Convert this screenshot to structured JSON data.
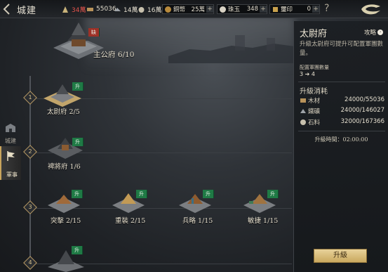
{
  "header": {
    "title": "城建",
    "resources": [
      {
        "icon": "troops-icon",
        "value": "34萬",
        "color": "#e0534b"
      },
      {
        "icon": "wood-icon",
        "value": "55036"
      },
      {
        "icon": "iron-icon",
        "value": "14萬"
      },
      {
        "icon": "stone-icon",
        "value": "16萬"
      }
    ],
    "pills": [
      {
        "icon": "copper-icon",
        "label": "銅幣",
        "value": "25萬"
      },
      {
        "icon": "jade-icon",
        "label": "珠玉",
        "value": "348"
      },
      {
        "icon": "gold-icon",
        "label": "璽印",
        "value": "0"
      }
    ],
    "help": "?"
  },
  "nav": [
    {
      "label": "城建",
      "active": false
    },
    {
      "label": "軍事",
      "active": true
    }
  ],
  "tree": {
    "main": {
      "name": "主公府 6/10",
      "badge": "缺"
    },
    "steps": [
      "1",
      "2",
      "3",
      "4"
    ],
    "tier1": {
      "name": "太尉府 2/5",
      "badge": "升"
    },
    "tier2": {
      "name": "裨將府 1/6",
      "badge": "升"
    },
    "tier3": [
      {
        "name": "突擊 2/15",
        "badge": "升"
      },
      {
        "name": "重裝 2/15",
        "badge": "升"
      },
      {
        "name": "兵略 1/15",
        "badge": "升"
      },
      {
        "name": "敏捷 1/15",
        "badge": "升"
      }
    ],
    "tier4": {
      "badge": "升"
    }
  },
  "panel": {
    "title": "太尉府",
    "guide": "攻略",
    "description": "升級太尉府可提升可配置軍團數量。",
    "sub_label": "配置軍團數量",
    "sub_from": "3",
    "sub_to": "4",
    "cost_title": "升級消耗",
    "costs": [
      {
        "icon": "wood-icon",
        "name": "木材",
        "value": "24000/55036"
      },
      {
        "icon": "iron-icon",
        "name": "鐵礦",
        "value": "24000/146027"
      },
      {
        "icon": "stone-icon",
        "name": "石料",
        "value": "32000/167366"
      }
    ],
    "time_label": "升級時間：",
    "time_value": "02:00:00",
    "button": "升級"
  }
}
